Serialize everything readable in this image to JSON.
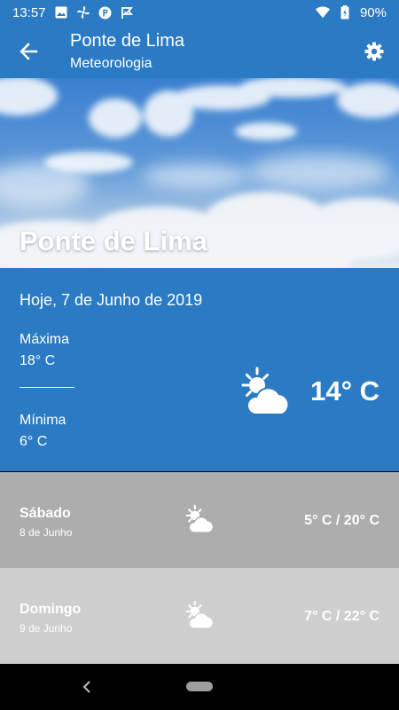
{
  "status_bar": {
    "time": "13:57",
    "battery": "90%",
    "left_icons": [
      "image-icon",
      "fan-icon",
      "parking-icon",
      "flag-icon"
    ],
    "right_icons": [
      "wifi-icon",
      "battery-icon"
    ]
  },
  "app_bar": {
    "title": "Ponte de Lima",
    "subtitle": "Meteorologia",
    "back_icon": "arrow-left-icon",
    "settings_icon": "gear-icon"
  },
  "hero": {
    "title": "Ponte de Lima"
  },
  "today": {
    "date": "Hoje, 7 de Junho de 2019",
    "max_label": "Máxima",
    "max_value": "18° C",
    "min_label": "Mínima",
    "min_value": "6° C",
    "current_temp": "14° C",
    "icon": "partly-cloudy-icon"
  },
  "forecast": [
    {
      "day": "Sábado",
      "date": "8 de Junho",
      "temps": "5° C / 20° C",
      "icon": "partly-cloudy-icon"
    },
    {
      "day": "Domingo",
      "date": "9 de Junho",
      "temps": "7° C / 22° C",
      "icon": "partly-cloudy-icon"
    }
  ],
  "colors": {
    "primary": "#2a7bc4",
    "row_1_bg": "#adadad",
    "row_2_bg": "#cfcfcf",
    "nav_bg": "#000000"
  }
}
